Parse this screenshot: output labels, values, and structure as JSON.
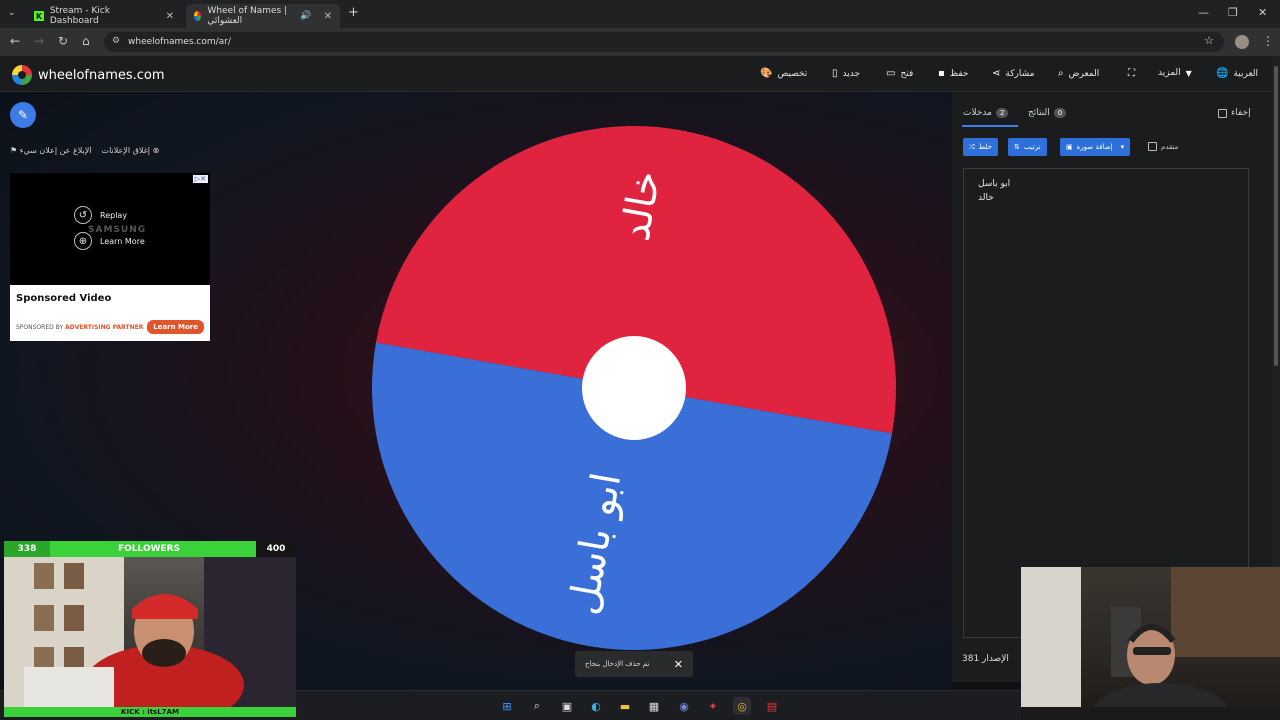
{
  "browser": {
    "tabs": [
      {
        "title": "Stream - Kick Dashboard",
        "active": false
      },
      {
        "title": "Wheel of Names | العشوائي",
        "active": true
      }
    ],
    "url": "wheelofnames.com/ar/"
  },
  "site": {
    "logo_text": "wheelofnames.com",
    "nav": {
      "customize": "تخصيص",
      "new": "جديد",
      "open": "فتح",
      "save": "حفظ",
      "share": "مشاركة",
      "gallery": "المعرض",
      "more": "المزيد",
      "language": "العربية"
    }
  },
  "stage": {
    "ad_controls": {
      "close_ads": "إغلاق الإعلانات",
      "report_ad": "الإبلاغ عن إعلان سيء"
    },
    "ad": {
      "replay": "Replay",
      "learn_more": "Learn More",
      "brand": "SAMSUNG",
      "title": "Sponsored Video",
      "sponsored_prefix": "SPONSORED BY",
      "sponsor": "ADVERTISING PARTNER",
      "cta": "Learn More"
    },
    "wheel": {
      "segments": [
        {
          "label": "خالد",
          "color": "#e0233f"
        },
        {
          "label": "ابو باسل",
          "color": "#3a6fd8"
        }
      ],
      "pointer_color": "#e0233f"
    },
    "toast": "تم حذف الإدخال بنجاح"
  },
  "panel": {
    "hide_label": "إخفاء",
    "tabs": [
      {
        "label": "مدخلات",
        "count": "2"
      },
      {
        "label": "النتائج",
        "count": "0"
      }
    ],
    "advanced_label": "متقدم",
    "buttons": {
      "add_image": "إضافة صورة",
      "sort": "ترتيب",
      "shuffle": "خلط"
    },
    "entries": [
      "ابو باسل",
      "خالد"
    ],
    "version": "الإصدار 381"
  },
  "overlay": {
    "followers_current": "338",
    "followers_label": "FOLLOWERS",
    "followers_goal": "400",
    "kick_handle": "KICK : itsL7AM"
  }
}
